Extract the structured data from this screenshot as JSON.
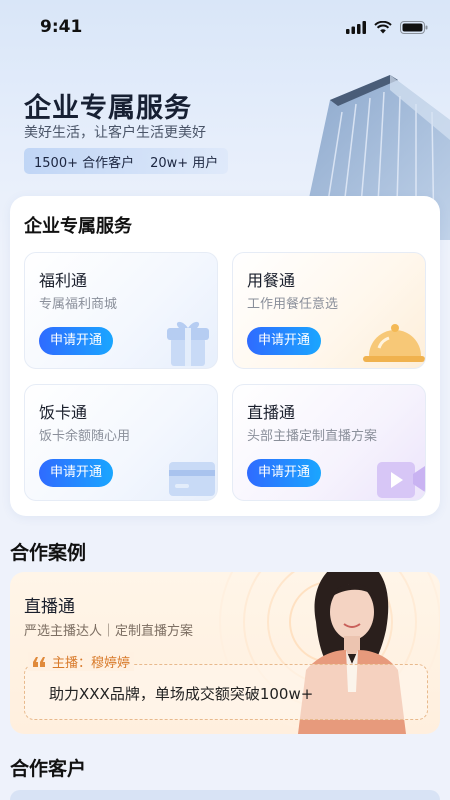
{
  "status_bar": {
    "time": "9:41"
  },
  "hero": {
    "title": "企业专属服务",
    "subtitle": "美好生活，让客户生活更美好",
    "stats": [
      "1500+ 合作客户",
      "20w+ 用户"
    ]
  },
  "services": {
    "heading": "企业专属服务",
    "items": [
      {
        "title": "福利通",
        "desc": "专属福利商城",
        "button": "申请开通",
        "icon": "gift-icon"
      },
      {
        "title": "用餐通",
        "desc": "工作用餐任意选",
        "button": "申请开通",
        "icon": "food-cloche-icon"
      },
      {
        "title": "饭卡通",
        "desc": "饭卡余额随心用",
        "button": "申请开通",
        "icon": "card-icon"
      },
      {
        "title": "直播通",
        "desc": "头部主播定制直播方案",
        "button": "申请开通",
        "icon": "video-icon"
      }
    ]
  },
  "cases": {
    "heading": "合作案例",
    "card": {
      "title": "直播通",
      "tags": "严选主播达人｜定制直播方案",
      "host": "主播：穆婷婷",
      "quote": "助力XXX品牌，单场成交额突破100w+"
    }
  },
  "customers": {
    "heading": "合作客户"
  },
  "colors": {
    "accent": "#2f6bff",
    "accent2": "#1aa6ff",
    "host": "#d87a2a"
  }
}
